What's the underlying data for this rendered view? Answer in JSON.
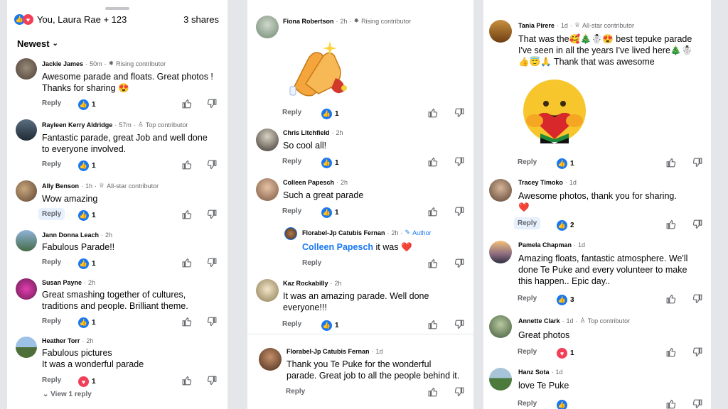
{
  "header": {
    "reactions_text": "You, Laura Rae + 123",
    "shares_text": "3 shares",
    "sort_label": "Newest"
  },
  "col1": [
    {
      "name": "Jackie James",
      "time": "50m",
      "badge": "Rising contributor",
      "text_lines": [
        "Awesome parade and floats. Great photos !",
        "Thanks for sharing 😍"
      ],
      "reaction": "like",
      "count": "1"
    },
    {
      "name": "Rayleen Kerry Aldridge",
      "time": "57m",
      "badge": "Top contributor",
      "text_lines": [
        "Fantastic parade, great Job and well done",
        "to everyone involved."
      ],
      "reaction": "like",
      "count": "1"
    },
    {
      "name": "Ally Benson",
      "time": "1h",
      "badge": "All-star contributor",
      "text_lines": [
        "Wow amazing"
      ],
      "reaction": "like",
      "count": "1"
    },
    {
      "name": "Jann Donna Leach",
      "time": "2h",
      "badge": "",
      "text_lines": [
        "Fabulous  Parade!!"
      ],
      "reaction": "like",
      "count": "1"
    },
    {
      "name": "Susan Payne",
      "time": "2h",
      "badge": "",
      "text_lines": [
        "Great smashing together of cultures,",
        "traditions and people. Brilliant theme."
      ],
      "reaction": "like",
      "count": "1"
    },
    {
      "name": "Heather Torr",
      "time": "2h",
      "badge": "",
      "text_lines": [
        "Fabulous pictures",
        "It was a wonderful parade"
      ],
      "reaction": "love",
      "count": "1"
    }
  ],
  "view_replies": "View 1 reply",
  "col2": [
    {
      "name": "Fiona Robertson",
      "time": "2h",
      "badge": "Rising contributor",
      "sticker": "clapping-hands",
      "reaction": "like",
      "count": "1"
    },
    {
      "name": "Chris Litchfield",
      "time": "2h",
      "text_lines": [
        "So cool all!"
      ],
      "reaction": "like",
      "count": "1"
    },
    {
      "name": "Colleen Papesch",
      "time": "2h",
      "text_lines": [
        "Such a great parade"
      ],
      "reaction": "like",
      "count": "1"
    },
    {
      "name": "Florabel-Jp Catubis Fernan",
      "time": "2h",
      "author_label": "Author",
      "mention": "Colleen Papesch",
      "text_after": " it was ❤️"
    },
    {
      "name": "Kaz Rockabilly",
      "time": "2h",
      "text_lines": [
        "It was an amazing parade.  Well done",
        "everyone!!!"
      ],
      "reaction": "like",
      "count": "1"
    },
    {
      "name": "Florabel-Jp Catubis Fernan",
      "time": "1d",
      "text_lines": [
        "Thank you Te Puke for the wonderful",
        "parade. Great job to all the people behind it."
      ]
    }
  ],
  "col3": [
    {
      "name": "Tania Pirere",
      "time": "1d",
      "badge": "All-star contributor",
      "text_lines": [
        "That was the🥰🎄☃️😍 best tepuke parade",
        "I've seen in all the years I've lived here🎄☃️",
        "👍😇🙏 Thank that was awesome"
      ],
      "sticker": "care-emoji",
      "reaction": "like",
      "count": "1"
    },
    {
      "name": "Tracey Timoko",
      "time": "1d",
      "text_lines": [
        "Awesome photos, thank you for sharing.",
        "❤️"
      ],
      "reaction": "like",
      "count": "2"
    },
    {
      "name": "Pamela Chapman",
      "time": "1d",
      "text_lines": [
        "Amazing floats, fantastic atmosphere. We'll",
        "done Te Puke and every volunteer to make",
        "this happen.. Epic day.."
      ],
      "reaction": "like",
      "count": "3"
    },
    {
      "name": "Annette Clark",
      "time": "1d",
      "badge": "Top contributor",
      "text_lines": [
        "Great photos"
      ],
      "reaction": "love",
      "count": "1"
    },
    {
      "name": "Hanz Sota",
      "time": "1d",
      "text_lines": [
        "love Te Puke"
      ],
      "reaction": "like",
      "count": ""
    }
  ],
  "labels": {
    "reply": "Reply"
  },
  "colors": {
    "like": "#1877f2",
    "love": "#f33e58",
    "meta": "#65676b"
  }
}
